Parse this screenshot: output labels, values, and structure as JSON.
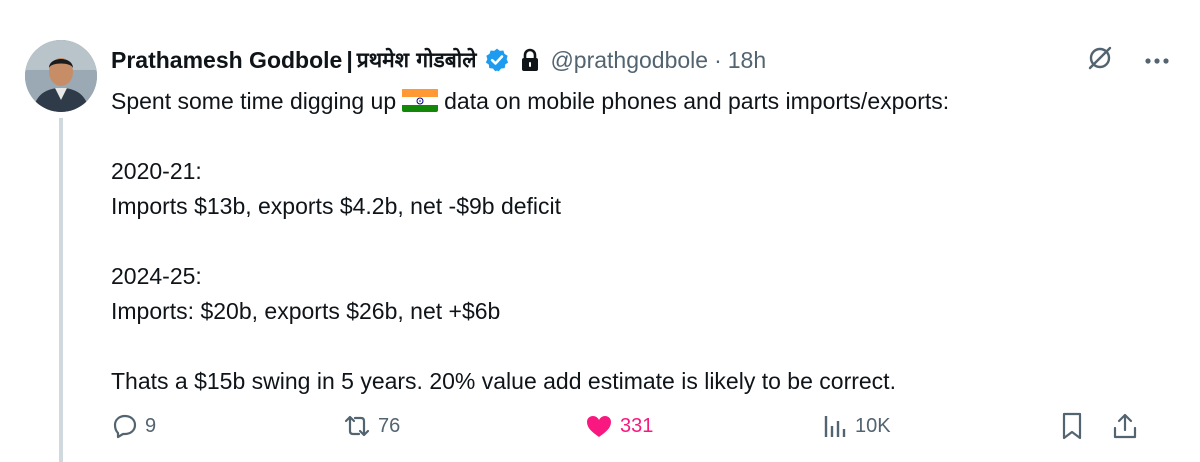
{
  "tweet": {
    "author_name": "Prathamesh Godbole",
    "separator": "|",
    "author_name_devanagari": "प्रथमेश गोडबोले",
    "handle": "@prathgodbole",
    "dot": "·",
    "time": "18h",
    "lines": {
      "l1a": "Spent some time digging up",
      "l1b": "data on mobile phones and parts imports/exports:",
      "l2": "2020-21:",
      "l3": "Imports $13b, exports $4.2b, net -$9b deficit",
      "l4": "2024-25:",
      "l5": "Imports: $20b, exports $26b, net +$6b",
      "l6": "Thats a $15b swing in 5 years. 20% value add estimate is likely to be correct."
    },
    "flag_icon": "india-flag-emoji"
  },
  "stats": {
    "replies": "9",
    "reposts": "76",
    "likes": "331",
    "views": "10K"
  },
  "colors": {
    "text": "#0f1419",
    "secondary": "#536471",
    "like": "#f91880",
    "verified": "#1d9bf0",
    "thread_line": "#cfd9de"
  }
}
